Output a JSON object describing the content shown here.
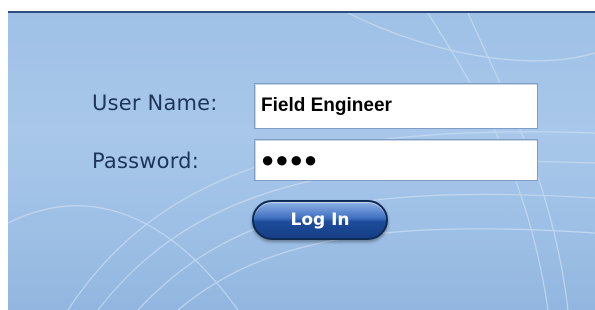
{
  "form": {
    "user_label": "User Name:",
    "user_value": "Field Engineer",
    "password_label": "Password:",
    "password_value": "●●●●",
    "login_label": "Log In"
  },
  "colors": {
    "panel_background": "#a8c7ea",
    "label_text": "#1d3557",
    "button": "#1e4c9a"
  }
}
